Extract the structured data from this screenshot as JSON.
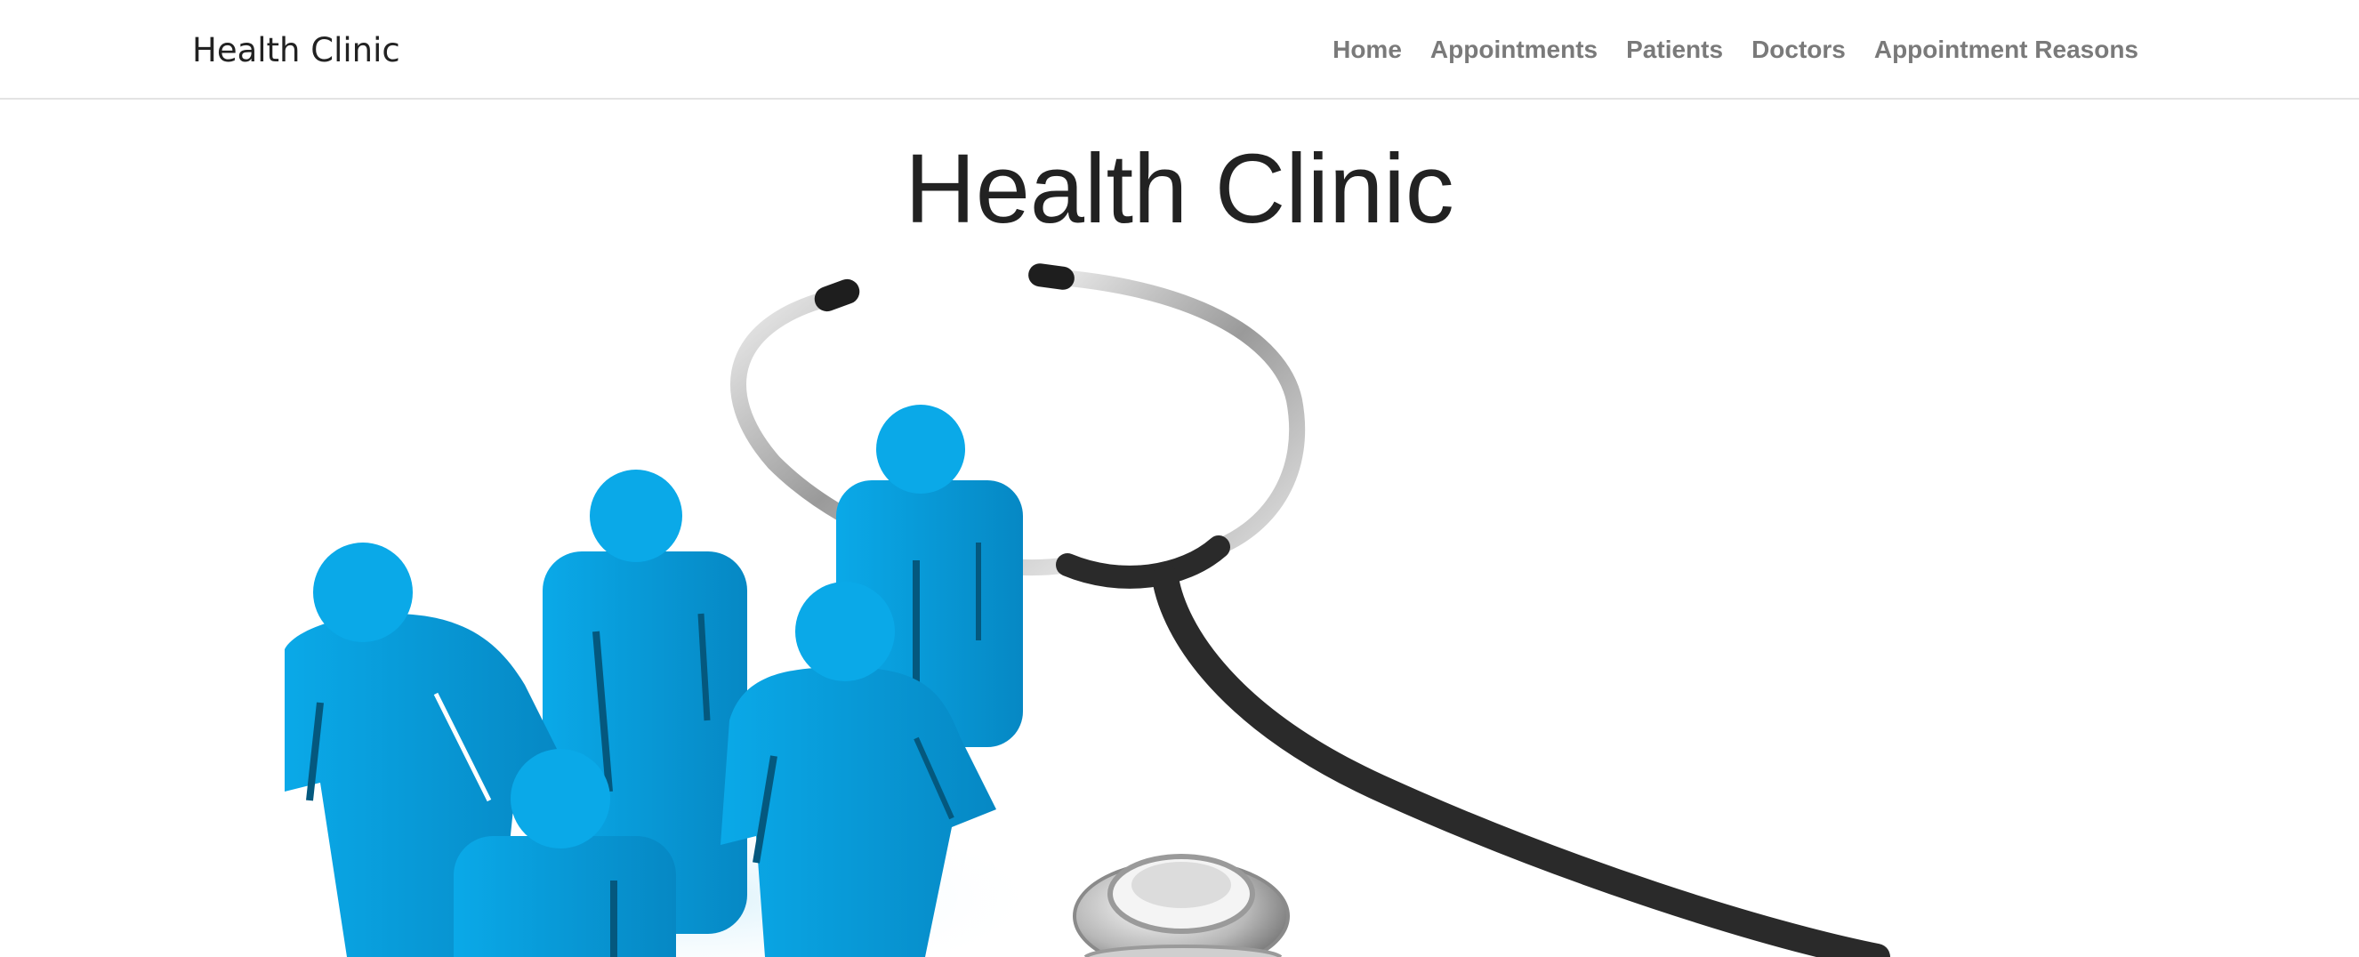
{
  "navbar": {
    "brand": "Health Clinic",
    "links": [
      "Home",
      "Appointments",
      "Patients",
      "Doctors",
      "Appointment Reasons"
    ]
  },
  "main": {
    "title": "Health Clinic",
    "image_alt": "people-and-stethoscope-illustration"
  },
  "colors": {
    "figure_blue": "#0a9fdc",
    "figure_dark": "#0677a8",
    "tube": "#2a2a2a",
    "metal": "#c9c9c9",
    "nav_text": "#7a7a7a"
  }
}
